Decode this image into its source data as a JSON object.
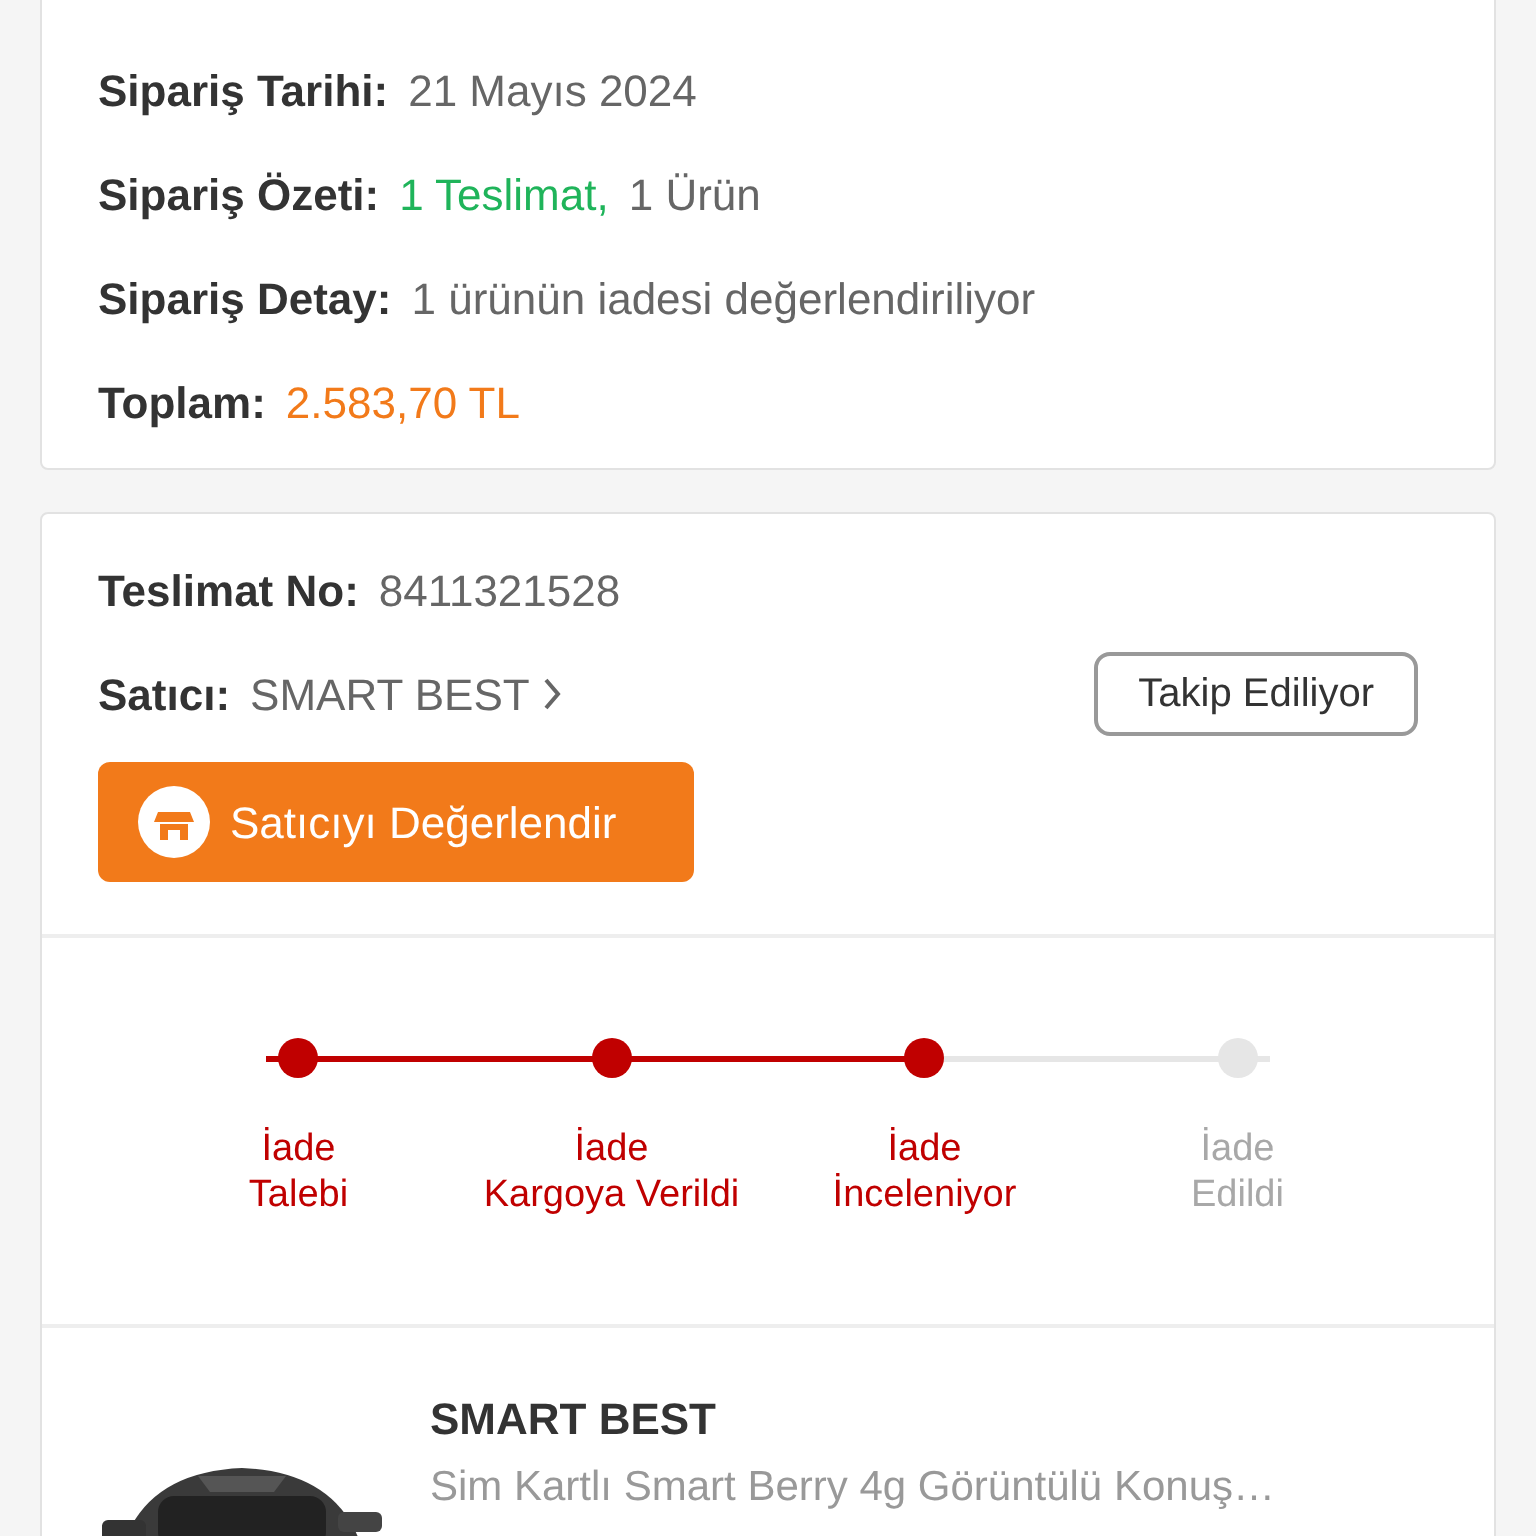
{
  "order": {
    "rows": [
      {
        "label": "Sipariş Tarihi:",
        "value": "21 Mayıs 2024",
        "kind": "plain"
      },
      {
        "label": "Sipariş Özeti:",
        "value": "1 Teslimat,",
        "extra": "1 Ürün",
        "kind": "summary"
      },
      {
        "label": "Sipariş Detay:",
        "value": "1 ürünün iadesi değerlendiriliyor",
        "kind": "plain"
      },
      {
        "label": "Toplam:",
        "value": "2.583,70 TL",
        "kind": "total"
      }
    ]
  },
  "delivery": {
    "no_label": "Teslimat No:",
    "no_value": "8411321528",
    "seller_label": "Satıcı:",
    "seller": "SMART BEST",
    "follow_button": "Takip Ediliyor",
    "rate_button": "Satıcıyı Değerlendir",
    "steps": [
      {
        "lines": [
          "İade",
          "Talebi"
        ],
        "done": true
      },
      {
        "lines": [
          "İade",
          "Kargoya Verildi"
        ],
        "done": true
      },
      {
        "lines": [
          "İade",
          "İnceleniyor"
        ],
        "done": true
      },
      {
        "lines": [
          "İade",
          "Edildi"
        ],
        "done": false
      }
    ],
    "product": {
      "seller": "SMART BEST",
      "name": "Sim Kartlı Smart Berry 4g Görüntülü Konuş…"
    }
  }
}
